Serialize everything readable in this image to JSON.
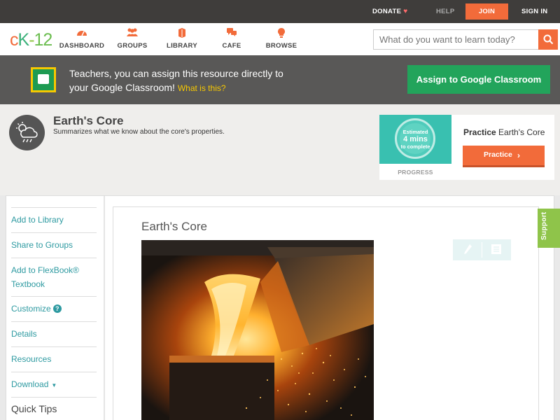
{
  "topbar": {
    "donate": "DONATE",
    "help": "HELP",
    "join": "JOIN",
    "signin": "SIGN IN"
  },
  "logo": {
    "c": "c",
    "k": "K",
    "dash": "-",
    "num": "12"
  },
  "nav": {
    "items": [
      {
        "label": "DASHBOARD",
        "icon": "dashboard-icon"
      },
      {
        "label": "GROUPS",
        "icon": "groups-icon"
      },
      {
        "label": "LIBRARY",
        "icon": "library-icon"
      },
      {
        "label": "CAFE",
        "icon": "cafe-icon"
      },
      {
        "label": "BROWSE",
        "icon": "browse-icon"
      }
    ]
  },
  "search": {
    "placeholder": "What do you want to learn today?"
  },
  "classroom": {
    "message_line1": "Teachers, you can assign this resource directly to",
    "message_line2": "your Google Classroom!",
    "what_link": "What is this?",
    "assign_button": "Assign to Google Classroom"
  },
  "concept": {
    "title": "Earth's Core",
    "subtitle": "Summarizes what we know about the core's properties.",
    "icon": "weather-cloud-icon"
  },
  "practice": {
    "estimated": "Estimated",
    "mins": "4 mins",
    "to_complete": "to complete",
    "progress_label": "PROGRESS",
    "title_bold": "Practice",
    "title_rest": "Earth's Core",
    "button": "Practice"
  },
  "sidebar": {
    "items": [
      {
        "label": "Add to Library"
      },
      {
        "label": "Share to Groups"
      },
      {
        "label": "Add to FlexBook® Textbook"
      },
      {
        "label": "Customize"
      },
      {
        "label": "Details"
      },
      {
        "label": "Resources"
      },
      {
        "label": "Download"
      }
    ],
    "quick_tips": "Quick Tips",
    "customize_help": "?"
  },
  "article": {
    "title": "Earth's Core",
    "image": "molten-metal-pour-image"
  },
  "support": {
    "label": "Support"
  },
  "colors": {
    "accent_orange": "#f26b3a",
    "teal_link": "#2e9aa1",
    "classroom_green": "#22a45b",
    "support_green": "#8fc44a",
    "topbar_bg": "#3f3d3b"
  }
}
